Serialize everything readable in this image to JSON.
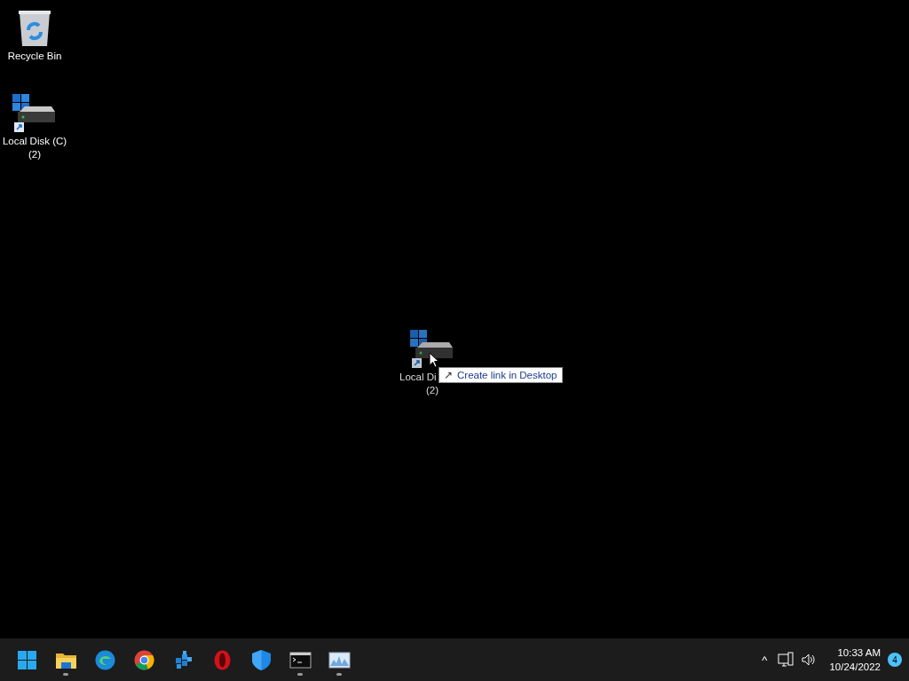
{
  "desktop_icons": [
    {
      "kind": "recycle",
      "label": "Recycle Bin"
    },
    {
      "kind": "drive",
      "label": "Local Disk (C)\n(2)"
    }
  ],
  "dragged_icon": {
    "kind": "drive",
    "label_visible": "Local Di",
    "label_line_2": "(2)"
  },
  "drag_tooltip": {
    "icon": "↗",
    "text": "Create link in Desktop"
  },
  "taskbar": {
    "apps": [
      {
        "kind": "start",
        "running": false
      },
      {
        "kind": "folder",
        "running": true
      },
      {
        "kind": "edge",
        "running": false
      },
      {
        "kind": "chrome",
        "running": false
      },
      {
        "kind": "cubes",
        "running": false
      },
      {
        "kind": "opera",
        "running": false
      },
      {
        "kind": "shield",
        "running": false
      },
      {
        "kind": "terminal",
        "running": true
      },
      {
        "kind": "monitor",
        "running": true
      }
    ],
    "tray": {
      "chevron": "^",
      "time": "10:33 AM",
      "date": "10/24/2022",
      "notifications": "4"
    }
  }
}
